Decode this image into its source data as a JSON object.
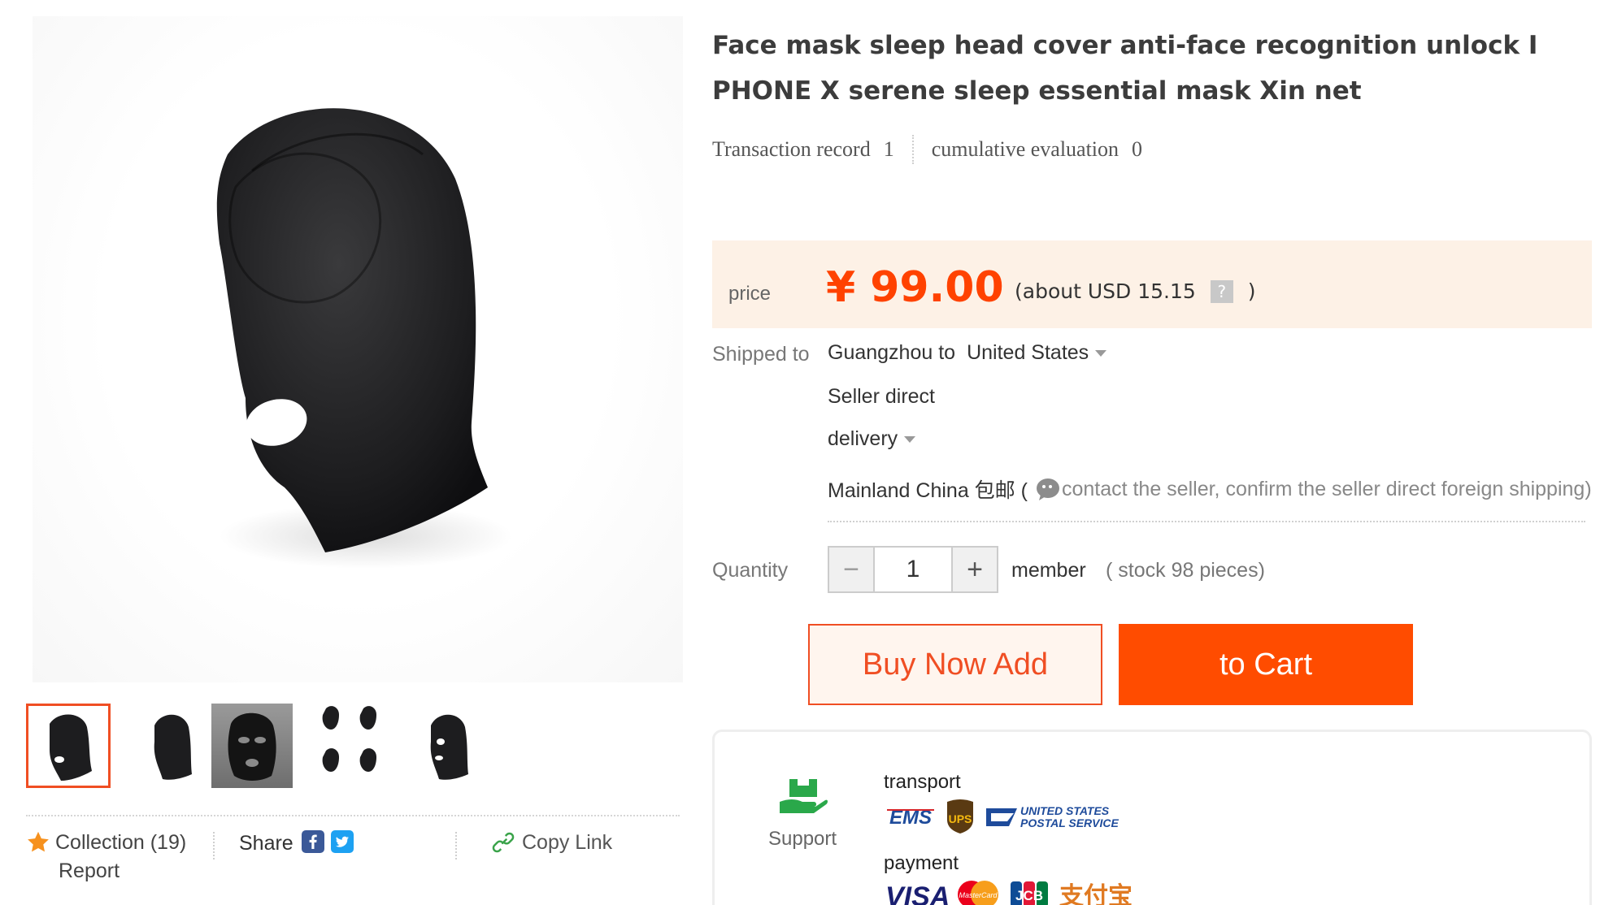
{
  "product": {
    "title": "Face mask sleep head cover anti-face recognition unlock I PHONE X serene sleep essential mask Xin net",
    "stats": {
      "transaction_label": "Transaction record",
      "transaction_count": "1",
      "evaluation_label": "cumulative evaluation",
      "evaluation_count": "0"
    }
  },
  "price": {
    "label": "price",
    "currency": "¥",
    "value": "99.00",
    "usd_prefix": "(about USD 15.15",
    "help": "?",
    "usd_suffix": ")",
    "accent_color": "#ff4200"
  },
  "shipping": {
    "label": "Shipped to",
    "from": "Guangzhou to",
    "destination": "United States",
    "seller_direct": "Seller direct",
    "delivery": "delivery",
    "region": "Mainland China 包邮 (",
    "note": "contact the seller, confirm the seller direct foreign shipping)"
  },
  "quantity": {
    "label": "Quantity",
    "minus": "−",
    "value": "1",
    "plus": "+",
    "unit": "member",
    "stock": "( stock 98 pieces)"
  },
  "buttons": {
    "buy": "Buy Now Add",
    "cart": "to Cart"
  },
  "gallery": {
    "thumb_count": 5,
    "active_index": 0,
    "actions": {
      "collection": "Collection (19)",
      "report": "Report",
      "share": "Share",
      "copy_link": "Copy Link"
    }
  },
  "support": {
    "label": "Support",
    "transport_title": "transport",
    "transport_logos": [
      "EMS",
      "UPS",
      "UNITED STATES",
      "POSTAL SERVICE"
    ],
    "payment_title": "payment",
    "payment_logos": [
      "VISA",
      "MasterCard",
      "JCB",
      "支付宝"
    ]
  },
  "icons": [
    "star-icon",
    "facebook-icon",
    "twitter-icon",
    "link-icon",
    "support-truck-icon",
    "wechat-icon"
  ]
}
